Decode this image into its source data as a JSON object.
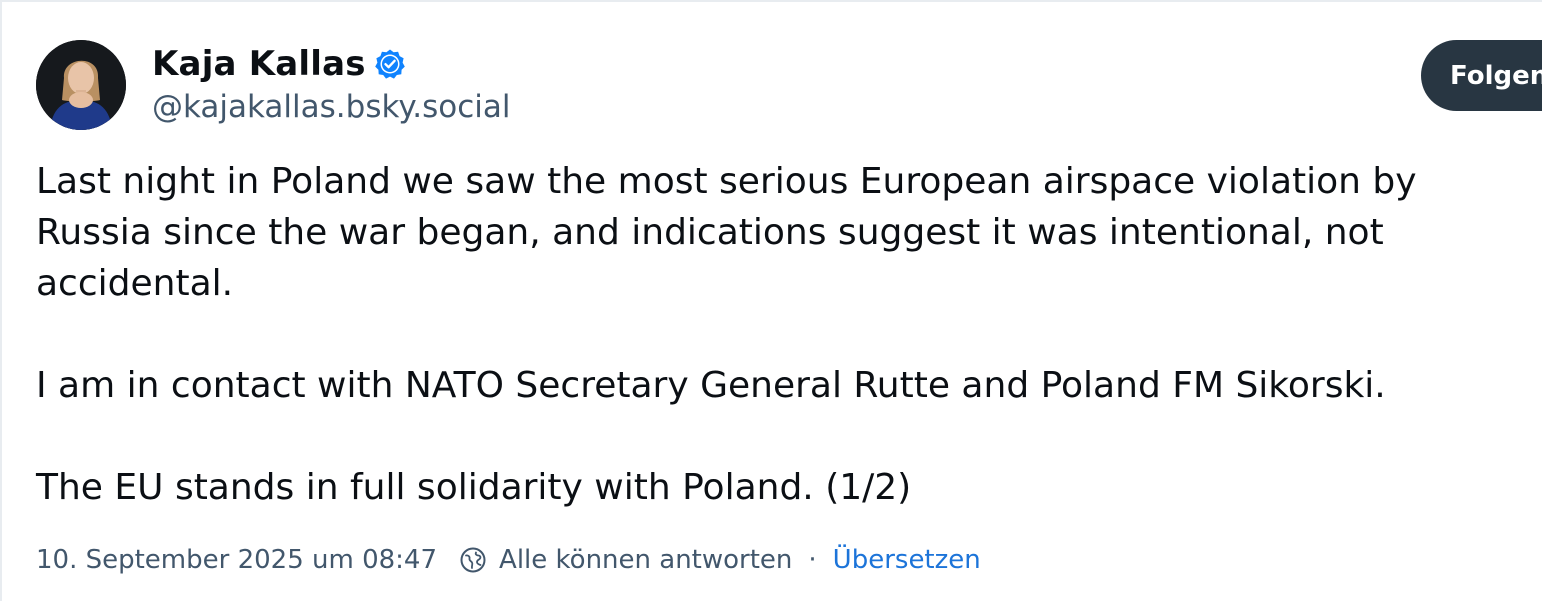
{
  "author": {
    "display_name": "Kaja Kallas",
    "handle": "@kajakallas.bsky.social",
    "verified_icon": "verified-check-icon",
    "avatar_icon": "profile-photo"
  },
  "follow_button": {
    "label": "Folgen"
  },
  "post": {
    "paragraphs": [
      "Last night in Poland we saw the most serious European airspace violation by Russia since the war began, and indications suggest it was intentional, not accidental.",
      "I am in contact with NATO Secretary General Rutte and Poland FM Sikorski.",
      "The EU stands in full solidarity with Poland. (1/2)"
    ]
  },
  "meta": {
    "timestamp": "10. September 2025 um 08:47",
    "reply_setting_icon": "globe-reply-icon",
    "reply_setting": "Alle können antworten",
    "separator": "·",
    "translate_label": "Übersetzen"
  },
  "colors": {
    "text_primary": "#0b0f14",
    "text_secondary": "#42576c",
    "link": "#1c74d9",
    "verified": "#1083fe",
    "button_bg": "#283642"
  }
}
